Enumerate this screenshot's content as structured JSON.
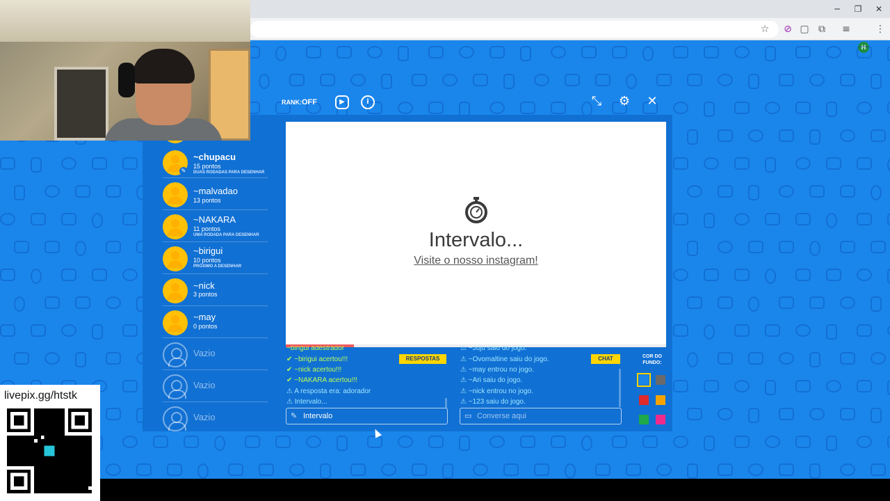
{
  "browser": {
    "window_controls": {
      "minimize": "─",
      "restore": "❐",
      "close": "✕"
    },
    "profile_initial": "H"
  },
  "game": {
    "rank_label": "RANK:",
    "rank_value": "OFF",
    "players": [
      {
        "name": "~chupacu",
        "points": "15 pontos",
        "status": "DUAS RODADAS PARA DESENHAR",
        "bold": true,
        "drawer": true
      },
      {
        "name": "~malvadao",
        "points": "13 pontos",
        "status": ""
      },
      {
        "name": "~NAKARA",
        "points": "11 pontos",
        "status": "UMA RODADA PARA DESENHAR"
      },
      {
        "name": "~birigui",
        "points": "10 pontos",
        "status": "PRÓXIMO A DESENHAR"
      },
      {
        "name": "~nick",
        "points": "3 pontos",
        "status": ""
      },
      {
        "name": "~may",
        "points": "0 pontos",
        "status": ""
      }
    ],
    "empty_slots": [
      "Vazio",
      "Vazio",
      "Vazio"
    ],
    "board": {
      "title": "Intervalo...",
      "link": "Visite o nosso instagram!",
      "progress": 0.18
    },
    "answers": {
      "button": "RESPOSTAS",
      "lines": [
        {
          "text": "~birigui adestrador",
          "color": "green"
        },
        {
          "text": "✔ ~birigui acertou!!!",
          "color": "green"
        },
        {
          "text": "✔ ~nick acertou!!!",
          "color": "green"
        },
        {
          "text": "✔ ~NAKARA acertou!!!",
          "color": "green"
        },
        {
          "text": "⚠ A resposta era: adorador",
          "color": "cyan"
        },
        {
          "text": "⚠ Intervalo...",
          "color": "cyan"
        }
      ],
      "input_value": "Intervalo"
    },
    "chat": {
      "button": "CHAT",
      "lines": [
        {
          "text": "⚠ ~Juju saiu do jogo.",
          "color": "cyan"
        },
        {
          "text": "⚠ ~Ovomaltine saiu do jogo.",
          "color": "cyan"
        },
        {
          "text": "⚠ ~may entrou no jogo.",
          "color": "cyan"
        },
        {
          "text": "⚠ ~Ari saiu do jogo.",
          "color": "cyan"
        },
        {
          "text": "⚠ ~nick entrou no jogo.",
          "color": "cyan"
        },
        {
          "text": "⚠ ~123 saiu do jogo.",
          "color": "cyan"
        }
      ],
      "placeholder": "Converse aqui"
    },
    "background_color": {
      "label_line1": "COR DO",
      "label_line2": "FUNDO:",
      "swatches": [
        "#1a86ec",
        "#6a6a6a",
        "#e02a2a",
        "#f5a300",
        "#1fa84a",
        "#ee2b8c"
      ],
      "selected": 0
    }
  },
  "overlay": {
    "qr_label": "livepix.gg/htstk"
  },
  "colors": {
    "background": "#1a86ec",
    "panel": "#1170d3",
    "accent": "#ffd600",
    "avatar": "#ffc107",
    "correct": "#b9ff55",
    "system": "#9fe6ff"
  }
}
